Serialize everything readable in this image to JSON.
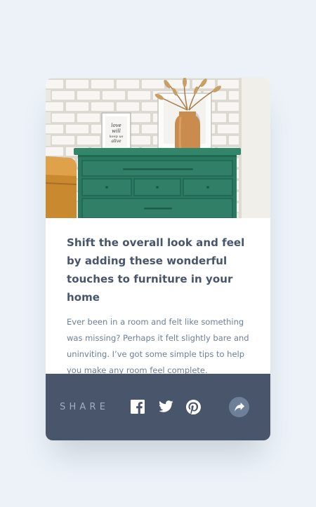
{
  "article": {
    "title": "Shift the overall look and feel by adding these wonderful touches to furniture in your home",
    "excerpt": "Ever been in a room and felt like something was missing? Perhaps it felt slightly bare and uninviting. I’ve got some simple tips to help you make any room feel complete.",
    "image_note": "love will keep us alive",
    "image_icons": [
      "framed-art-print",
      "vase-with-dried-grass",
      "green-drawers-dresser"
    ]
  },
  "share": {
    "label": "SHARE",
    "icons": [
      "facebook-icon",
      "twitter-icon",
      "pinterest-icon",
      "share-arrow-icon"
    ]
  },
  "colors": {
    "page_background": "#ecf2f8",
    "share_bar": "#48556a",
    "title_text": "#48556a",
    "body_text": "#6e8098",
    "share_label": "#9eafc2",
    "share_button": "#6e8098",
    "dresser": "#2c7a62"
  }
}
